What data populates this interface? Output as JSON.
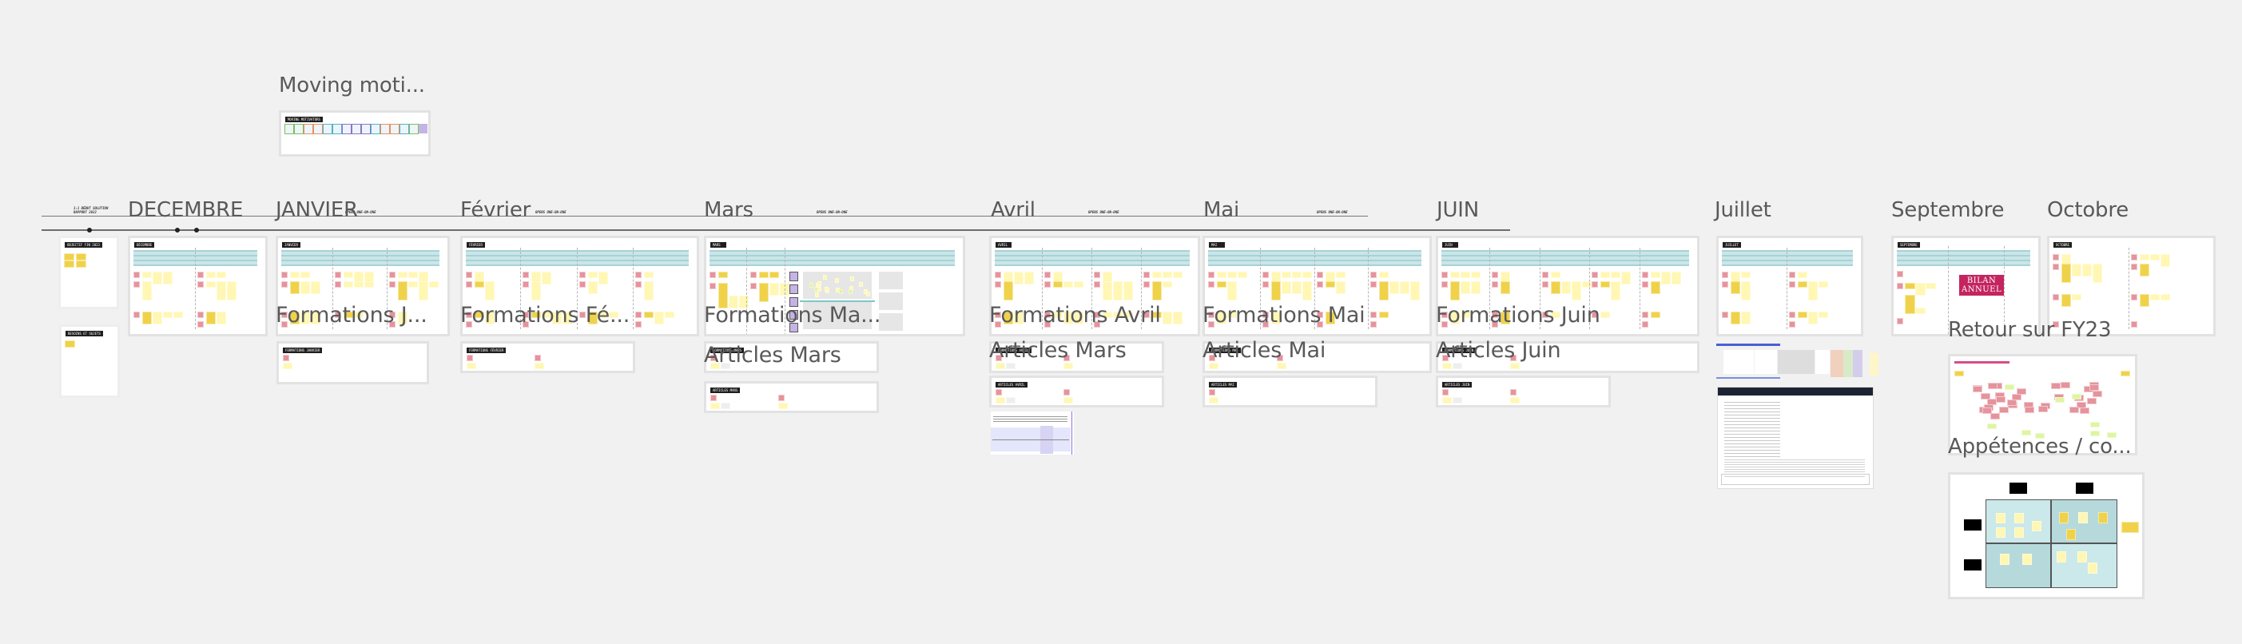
{
  "board": {
    "background": "#f1f1f1",
    "sticky_colors": {
      "pale": "#fff7b3",
      "yellow": "#efd24a",
      "pink": "#e5939c",
      "green": "#dff5a1",
      "purple": "#c5b3e6"
    }
  },
  "titles": {
    "moving": "Moving moti...",
    "decembre": "DECEMBRE",
    "janvier": "JANVIER",
    "fevrier": "Février",
    "mars": "Mars",
    "avril": "Avril",
    "mai": "Mai",
    "juin": "JUIN",
    "juillet": "Juillet",
    "septembre": "Septembre",
    "octobre": "Octobre",
    "form_janv": "Formations J...",
    "form_fev": "Formations Fé...",
    "form_mars": "Formations Ma...",
    "art_mars_1": "Articles Mars",
    "form_avril": "Formations Avril",
    "art_mars_2": "Articles Mars",
    "form_mai": "Formations Mai",
    "art_mai": "Articles Mai",
    "form_juin": "Formations Juin",
    "art_juin": "Articles Juin",
    "retour": "Retour sur FY23",
    "appetences": "Appétences / co..."
  },
  "tags": {
    "moving": "MOVING MOTIVATORS",
    "objectif": "OBJECTIF FIN 2023",
    "besoins": "BESOINS ET SUJETS",
    "decembre": "DÉCEMBRE",
    "janvier": "JANVIER",
    "fevrier": "FÉVRIER",
    "mars": "MARS",
    "avril": "AVRIL",
    "mai": "MAI",
    "juin": "JUIN",
    "juillet": "JUILLET",
    "septembre": "SEPTEMBRE",
    "octobre": "OCTOBRE",
    "formations_janv": "FORMATIONS JANVIER",
    "formations_fev": "FORMATIONS FÉVRIER",
    "formations_mars": "FORMATIONS MARS",
    "articles_mars": "ARTICLES MARS",
    "formations_avril": "FORMATIONS AVRIL",
    "articles_avril": "ARTICLES AVRIL",
    "formations_mai": "FORMATIONS MAI",
    "articles_mai": "ARTICLES MAI",
    "formations_juin": "FORMATIONS JUIN",
    "articles_juin": "ARTICLES JUIN"
  },
  "timeline": {
    "start_label": "1:1 DÉBUT SOLUTION\nRAPPORT 2022",
    "milestone_label": "OPENS ONE-ON-ONE"
  },
  "septembre": {
    "badge_line1": "BILAN",
    "badge_line2": "ANNUEL"
  }
}
